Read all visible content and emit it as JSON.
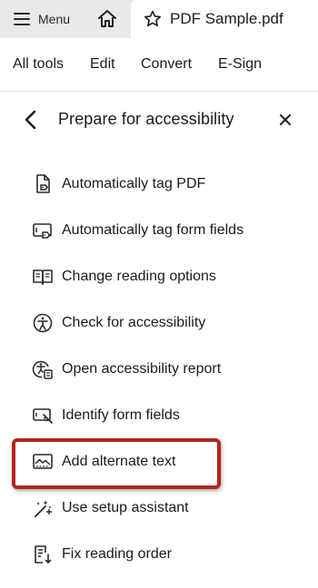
{
  "topbar": {
    "menu_label": "Menu",
    "home_icon": "home-icon",
    "document_name": "PDF Sample.pdf",
    "star_icon": "star-icon"
  },
  "toolbar": {
    "items": [
      "All tools",
      "Edit",
      "Convert",
      "E-Sign"
    ]
  },
  "panel": {
    "title": "Prepare for accessibility",
    "back_icon": "chevron-left-icon",
    "close_icon": "close-icon",
    "items": [
      {
        "label": "Automatically tag PDF",
        "icon": "auto-tag-pdf-icon"
      },
      {
        "label": "Automatically tag form fields",
        "icon": "auto-tag-form-fields-icon"
      },
      {
        "label": "Change reading options",
        "icon": "book-icon"
      },
      {
        "label": "Check for accessibility",
        "icon": "accessibility-check-icon"
      },
      {
        "label": "Open accessibility report",
        "icon": "accessibility-report-icon"
      },
      {
        "label": "Identify form fields",
        "icon": "identify-form-fields-icon"
      },
      {
        "label": "Add alternate text",
        "icon": "alternate-text-icon"
      },
      {
        "label": "Use setup assistant",
        "icon": "setup-assistant-icon"
      },
      {
        "label": "Fix reading order",
        "icon": "reading-order-icon"
      }
    ],
    "highlighted_item": "Add alternate text",
    "highlight_color": "#b3261e"
  }
}
